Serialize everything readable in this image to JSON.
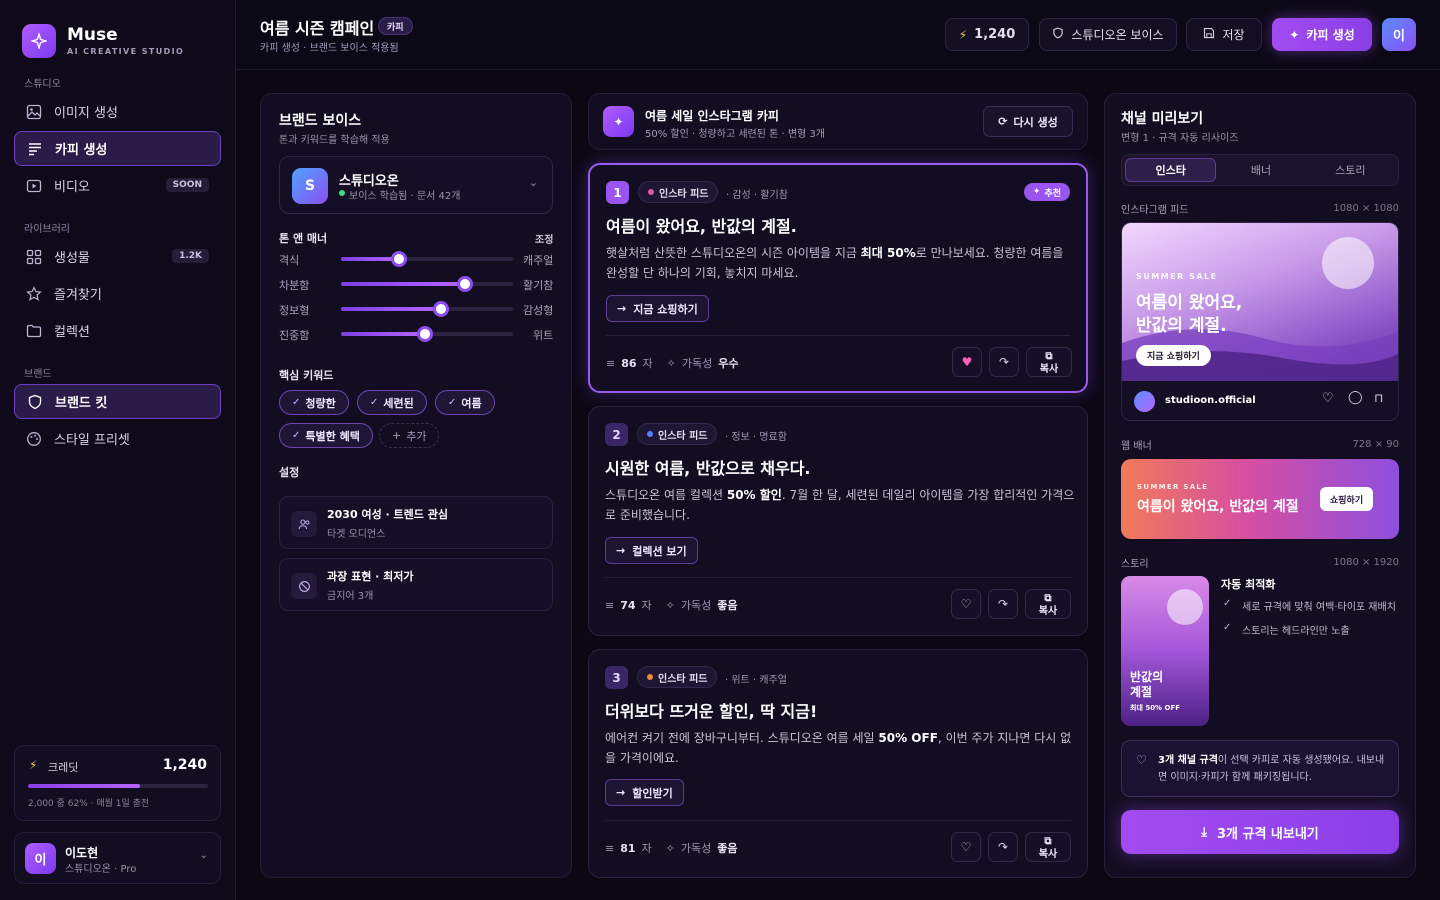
{
  "app": {
    "name": "Muse",
    "subtitle": "AI CREATIVE STUDIO"
  },
  "sidebar": {
    "studio_label": "스튜디오",
    "studio_items": [
      {
        "label": "이미지 생성",
        "icon": "image-icon"
      },
      {
        "label": "카피 생성",
        "icon": "text-lines-icon",
        "active": true
      },
      {
        "label": "비디오",
        "icon": "video-icon",
        "badge": "SOON"
      }
    ],
    "library_label": "라이브러리",
    "library_items": [
      {
        "label": "생성물",
        "icon": "grid-icon",
        "badge": "1.2K"
      },
      {
        "label": "즐겨찾기",
        "icon": "star-icon"
      },
      {
        "label": "컬렉션",
        "icon": "folder-icon"
      }
    ],
    "brand_label": "브랜드",
    "brand_items": [
      {
        "label": "브랜드 킷",
        "icon": "shield-icon",
        "active": true
      },
      {
        "label": "스타일 프리셋",
        "icon": "palette-icon"
      }
    ],
    "credits": {
      "label": "크레딧",
      "value": "1,240",
      "fraction": 0.62,
      "note": "2,000 중 62% · 매월 1일 충전"
    },
    "user": {
      "initial": "이",
      "name": "이도현",
      "plan": "스튜디오온 · Pro"
    }
  },
  "header": {
    "title": "여름 시즌 캠페인",
    "badge": "카피",
    "subtitle": "카피 생성 · 브랜드 보이스 적용됨",
    "credits": "1,240",
    "voice_button": "스튜디오온 보이스",
    "save_button": "저장",
    "generate_button": "카피 생성",
    "avatar": "이"
  },
  "brand_voice": {
    "title": "브랜드 보이스",
    "subtitle": "톤과 키워드를 학습해 적용",
    "brand": {
      "initial": "S",
      "name": "스튜디오온",
      "status": "보이스 학습됨 · 문서 42개"
    },
    "tone_label": "톤 앤 매너",
    "tone_adjust": "조정",
    "sliders": [
      {
        "left": "격식",
        "right": "캐주얼",
        "value": 0.34
      },
      {
        "left": "차분함",
        "right": "활기참",
        "value": 0.72
      },
      {
        "left": "정보형",
        "right": "감성형",
        "value": 0.58
      },
      {
        "left": "진중함",
        "right": "위트",
        "value": 0.49
      }
    ],
    "keywords_label": "핵심 키워드",
    "keywords": [
      "청량한",
      "세련된",
      "여름",
      "특별한 혜택"
    ],
    "add_keyword": "추가",
    "settings_label": "설정",
    "settings": [
      {
        "title": "2030 여성 · 트렌드 관심",
        "sub": "타겟 오디언스",
        "icon": "users-icon"
      },
      {
        "title": "과장 표현 · 최저가",
        "sub": "금지어 3개",
        "icon": "ban-icon"
      }
    ]
  },
  "request": {
    "title": "여름 세일 인스타그램 카피",
    "sub": "50% 할인 · 청량하고 세련된 톤 · 변형 3개",
    "regenerate": "다시 생성"
  },
  "copies": [
    {
      "num": "1",
      "channel": "인스타 피드",
      "dot": "#e05aa8",
      "tone": "· 감성 · 활기참",
      "recommend": "추천",
      "title": "여름이 왔어요, 반값의 계절.",
      "body_pre": "햇살처럼 산뜻한 스튜디오온의 시즌 아이템을 지금 ",
      "body_bold": "최대 50%",
      "body_post": "로 만나보세요. 청량한 여름을 완성할 단 하나의 기회, 놓치지 마세요.",
      "cta": "지금 쇼핑하기",
      "chars": "86",
      "chars_unit": "자",
      "read_label": "가독성",
      "read_value": "우수",
      "liked": true,
      "copy_label": "복사"
    },
    {
      "num": "2",
      "channel": "인스타 피드",
      "dot": "#5a7cff",
      "tone": "· 정보 · 명료함",
      "title": "시원한 여름, 반값으로 채우다.",
      "body_pre": "스튜디오온 여름 컬렉션 ",
      "body_bold": "50% 할인",
      "body_post": ". 7월 한 달, 세련된 데일리 아이템을 가장 합리적인 가격으로 준비했습니다.",
      "cta": "컬렉션 보기",
      "chars": "74",
      "chars_unit": "자",
      "read_label": "가독성",
      "read_value": "좋음",
      "liked": false,
      "copy_label": "복사"
    },
    {
      "num": "3",
      "channel": "인스타 피드",
      "dot": "#f08a3a",
      "tone": "· 위트 · 캐주얼",
      "title": "더위보다 뜨거운 할인, 딱 지금!",
      "body_pre": "에어컨 켜기 전에 장바구니부터. 스튜디오온 여름 세일 ",
      "body_bold": "50% OFF",
      "body_post": ", 이번 주가 지나면 다시 없을 가격이에요.",
      "cta": "할인받기",
      "chars": "81",
      "chars_unit": "자",
      "read_label": "가독성",
      "read_value": "좋음",
      "liked": false,
      "copy_label": "복사"
    }
  ],
  "preview": {
    "title": "채널 미리보기",
    "subtitle": "변형 1 · 규격 자동 리사이즈",
    "tabs": [
      "인스타",
      "배너",
      "스토리"
    ],
    "insta": {
      "label": "인스타그램 피드",
      "size": "1080 × 1080",
      "kicker": "SUMMER SALE",
      "headline1": "여름이 왔어요,",
      "headline2": "반값의 계절.",
      "cta": "지금 쇼핑하기",
      "account": "studioon.official"
    },
    "banner": {
      "label": "웹 배너",
      "size": "728 × 90",
      "kicker": "SUMMER SALE",
      "headline": "여름이 왔어요, 반값의 계절",
      "cta": "쇼핑하기"
    },
    "story": {
      "label": "스토리",
      "size": "1080 × 1920",
      "headline1": "반값의",
      "headline2": "계절",
      "sub": "최대 50% OFF",
      "opt_title": "자동 최적화",
      "opt_items": [
        "세로 규격에 맞춰 여백·타이포 재배치",
        "스토리는 헤드라인만 노출"
      ]
    },
    "info_bold": "3개 채널 규격",
    "info_text": "이 선택 카피로 자동 생성됐어요. 내보내면 이미지·카피가 함께 패키징됩니다.",
    "export": "3개 규격 내보내기"
  },
  "colors": {
    "accent": "#9a55f0",
    "background": "#0b0814",
    "panel": "#120d20"
  }
}
